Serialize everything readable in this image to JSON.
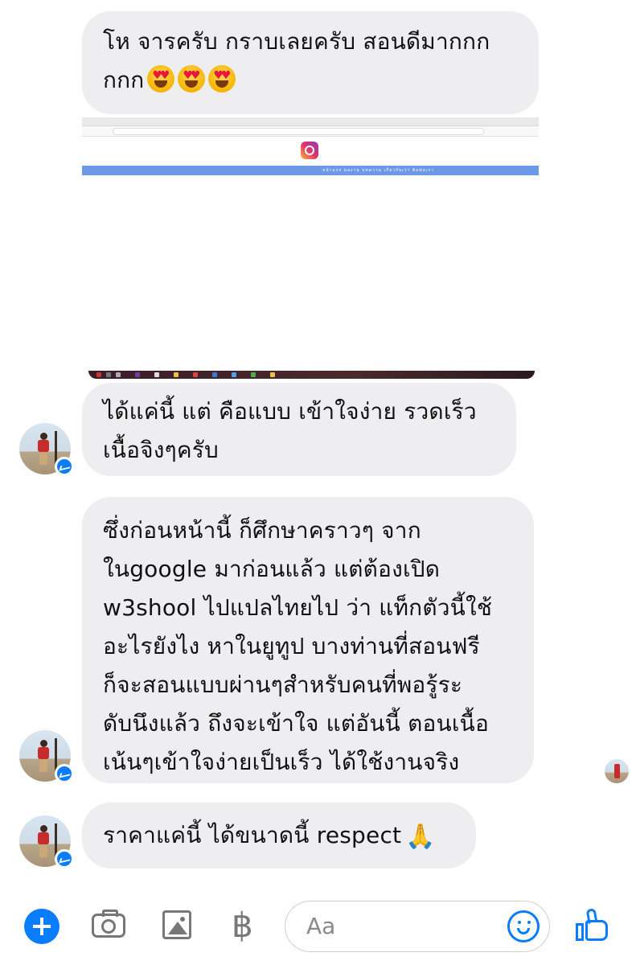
{
  "messages": [
    {
      "text": "โห จารครับ กราบเลยครับ สอนดีมากกก\nกกก",
      "emoji": "heart-eyes x3"
    },
    {
      "text": "ได้แค่นี้ แต่ คือแบบ เข้าใจง่าย รวดเร็ว\nเนื้อจิงๆครับ"
    },
    {
      "text": "ซึ่งก่อนหน้านี้ ก็ศึกษาคราวๆ จาก\nในgoogle มาก่อนแล้ว แต่ต้องเปิด\nw3shool ไปแปลไทยไป ว่า แท็กตัวนี้ใช้\nอะไรยังไง หาในยูทูป บางท่านที่สอนฟรี\nก็จะสอนแบบผ่านๆสำหรับคนที่พอรู้ระ\nดับนึงแล้ว ถึงจะเข้าใจ แต่อันนี้ ตอนเนื้อ\nเน้นๆเข้าใจง่ายเป็นเร็ว ได้ใช้งานจริง"
    },
    {
      "text": "ราคาแค่นี้ ได้ขนาดนี้  respect",
      "emoji": "folded-hands"
    }
  ],
  "screenshot": {
    "nav_text": "หน้าแรก   ผลงาน   บทความ   เกี่ยวกับเรา   ติดต่อเรา",
    "icon": "instagram-icon"
  },
  "composer": {
    "placeholder": "Aa",
    "icons": [
      "plus-icon",
      "camera-icon",
      "gallery-icon",
      "baht-icon",
      "emoji-icon",
      "thumbs-up-icon"
    ],
    "baht_symbol": "฿"
  },
  "colors": {
    "accent": "#0a7cff",
    "bubble": "#eeeef0"
  }
}
